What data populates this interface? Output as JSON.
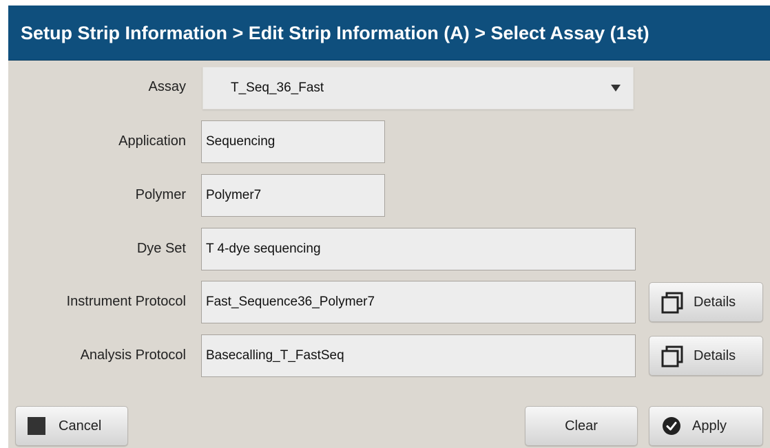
{
  "title": "Setup Strip Information > Edit Strip Information (A) > Select Assay (1st)",
  "form": {
    "assay": {
      "label": "Assay",
      "value": "T_Seq_36_Fast"
    },
    "application": {
      "label": "Application",
      "value": "Sequencing"
    },
    "polymer": {
      "label": "Polymer",
      "value": "Polymer7"
    },
    "dye_set": {
      "label": "Dye Set",
      "value": "T 4-dye sequencing"
    },
    "instrument_protocol": {
      "label": "Instrument Protocol",
      "value": "Fast_Sequence36_Polymer7"
    },
    "analysis_protocol": {
      "label": "Analysis Protocol",
      "value": "Basecalling_T_FastSeq"
    }
  },
  "buttons": {
    "details_label": "Details",
    "cancel_label": "Cancel",
    "clear_label": "Clear",
    "apply_label": "Apply"
  },
  "icons": {
    "details": "window-stack-icon",
    "cancel": "stop-square-icon",
    "apply": "checkmark-circle-icon"
  },
  "colors": {
    "title_bar": "#0f4f7d",
    "panel": "#dcd8d1",
    "field": "#ededed"
  }
}
